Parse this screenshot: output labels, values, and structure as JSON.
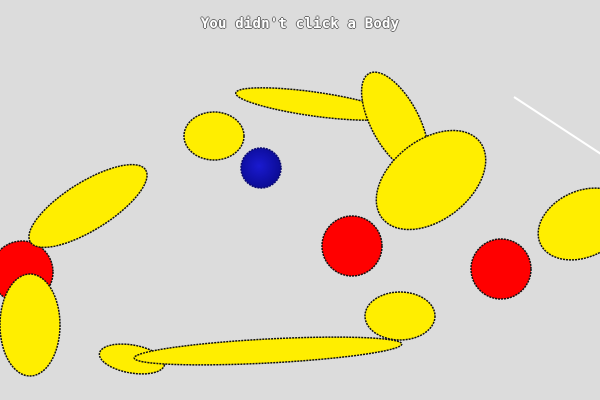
{
  "status_message": "You didn't click a Body",
  "colors": {
    "background": "#dcdcdc",
    "ellipse_fill": "#ffee00",
    "ball_red": "#ff0000",
    "ball_blue": "#1010b8",
    "outline": "#111111",
    "drag_line": "#ffffff"
  }
}
